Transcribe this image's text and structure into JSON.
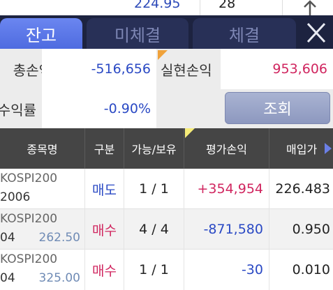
{
  "top_strip": {
    "value1": "224.95",
    "value2": "28"
  },
  "tabs": [
    {
      "label": "잔고",
      "active": true
    },
    {
      "label": "미체결",
      "active": false
    },
    {
      "label": "체결",
      "active": false
    }
  ],
  "summary": {
    "eval_pl_label": "총손익",
    "eval_pl_value": "-516,656",
    "realized_pl_label": "실현손익",
    "realized_pl_value": "953,606",
    "return_label": "수익률",
    "return_value": "-0.90%",
    "query_button": "조회"
  },
  "table": {
    "headers": [
      "종목명",
      "구분",
      "가능/보유",
      "평가손익",
      "매입가"
    ],
    "rows": [
      {
        "name_line1": "KOSPI200",
        "name_line2": "2006",
        "price": "",
        "side": "매도",
        "qty": "1 / 1",
        "pl": "+354,954",
        "avg": "226.483"
      },
      {
        "name_line1": "KOSPI200",
        "name_line2": "04",
        "price": "262.50",
        "side": "매수",
        "qty": "4 / 4",
        "pl": "-871,580",
        "avg": "0.950"
      },
      {
        "name_line1": "KOSPI200",
        "name_line2": "04",
        "price": "325.00",
        "side": "매수",
        "qty": "1 / 1",
        "pl": "-30",
        "avg": "0.010"
      }
    ]
  },
  "colors": {
    "active_tab": "#5b78e8",
    "tab_bar": "#1d2340",
    "negative_blue": "#2a49c4",
    "positive_red": "#d0255f",
    "header_bg": "#454545",
    "marker_yellow": "#f6ec78",
    "marker_orange": "#f0a23a"
  },
  "icons": {
    "close": "close-x-icon",
    "up_arrow": "up-arrow-icon",
    "scroll_right": "triangle-right-icon"
  }
}
